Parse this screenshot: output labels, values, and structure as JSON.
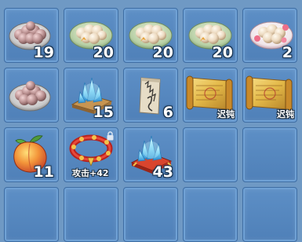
{
  "inventory": {
    "slots": [
      {
        "item": "dumplings-plate-red-icon",
        "count": "19"
      },
      {
        "item": "dumplings-plate-green-icon",
        "count": "20"
      },
      {
        "item": "dumplings-plate-green-icon",
        "count": "20"
      },
      {
        "item": "dumplings-plate-green-icon",
        "count": "20"
      },
      {
        "item": "dumplings-plate-flowers-icon",
        "count": "2"
      },
      {
        "item": "dumplings-plate-red-icon",
        "count": ""
      },
      {
        "item": "crystal-cluster-tray-icon",
        "count": "15"
      },
      {
        "item": "rune-scroll-icon",
        "count": "6"
      },
      {
        "item": "golden-scroll-icon",
        "tag": "迟钝"
      },
      {
        "item": "golden-scroll-icon",
        "tag": "迟钝"
      },
      {
        "item": "peach-icon",
        "count": "11"
      },
      {
        "item": "red-bracelet-icon",
        "tag": "攻击+42",
        "locked": true
      },
      {
        "item": "crystal-cluster-cushion-icon",
        "count": "43"
      }
    ]
  },
  "colors": {
    "slot_bg": "#5d8fc6",
    "slot_border": "#3f6ea4",
    "count_text": "#ffffff"
  }
}
